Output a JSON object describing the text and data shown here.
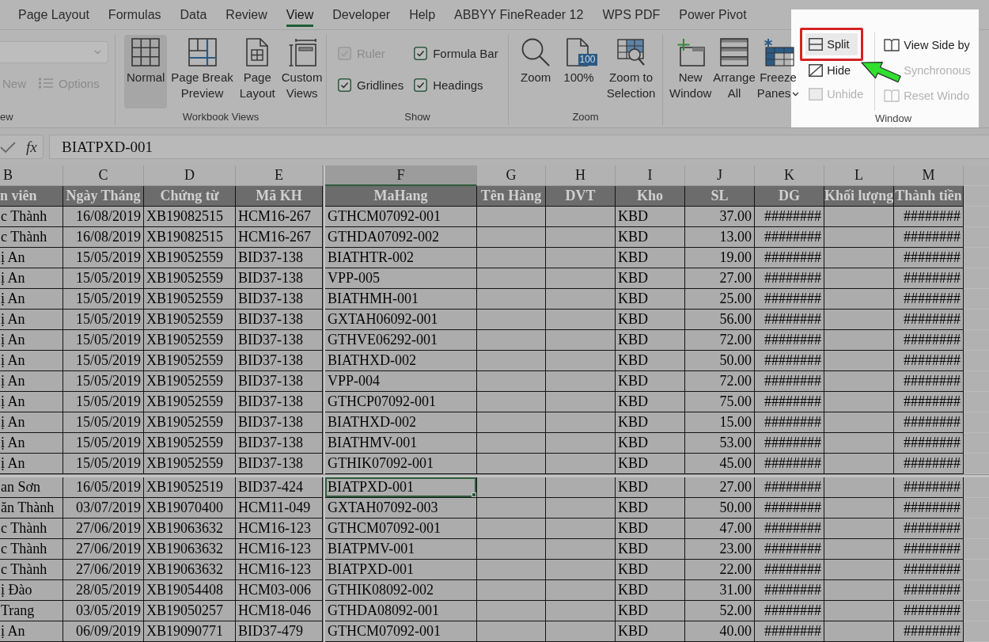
{
  "tabs": [
    {
      "label": "Page Layout",
      "selected": false
    },
    {
      "label": "Formulas",
      "selected": false
    },
    {
      "label": "Data",
      "selected": false
    },
    {
      "label": "Review",
      "selected": false
    },
    {
      "label": "View",
      "selected": true
    },
    {
      "label": "Developer",
      "selected": false
    },
    {
      "label": "Help",
      "selected": false
    },
    {
      "label": "ABBYY FineReader 12",
      "selected": false
    },
    {
      "label": "WPS PDF",
      "selected": false
    },
    {
      "label": "Power Pivot",
      "selected": false
    }
  ],
  "ribbon": {
    "sheet_view": {
      "label": "ew",
      "selector": {
        "disabled": true
      },
      "buttons": [
        {
          "label": "New",
          "kind": "plain",
          "disabled": true
        },
        {
          "label": "Options",
          "kind": "list",
          "disabled": true
        }
      ]
    },
    "workbook_views": {
      "label": "Workbook Views",
      "buttons": [
        {
          "label": "Normal",
          "kind": "normal",
          "selected": true
        },
        {
          "label": "Page Break Preview",
          "kind": "page_break",
          "selected": false
        },
        {
          "label": "Page Layout",
          "kind": "page_layout",
          "selected": false
        },
        {
          "label": "Custom Views",
          "kind": "custom_views",
          "selected": false
        }
      ]
    },
    "show": {
      "label": "Show",
      "options": [
        {
          "label": "Ruler",
          "checked": true,
          "disabled": true
        },
        {
          "label": "Formula Bar",
          "checked": true,
          "disabled": false
        },
        {
          "label": "Gridlines",
          "checked": true,
          "disabled": false
        },
        {
          "label": "Headings",
          "checked": true,
          "disabled": false
        }
      ]
    },
    "zoom": {
      "label": "Zoom",
      "buttons": [
        {
          "label": "Zoom",
          "kind": "zoom"
        },
        {
          "label": "100%",
          "kind": "actual_size",
          "badge": "100"
        },
        {
          "label": "Zoom to Selection",
          "kind": "zoom_selection"
        }
      ]
    },
    "window": {
      "label": "Window",
      "spotlight": true,
      "buttons": [
        {
          "label": "New Window",
          "kind": "new_window",
          "dropdown": false
        },
        {
          "label": "Arrange All",
          "kind": "arrange_all",
          "dropdown": false
        },
        {
          "label": "Freeze Panes",
          "kind": "freeze_panes",
          "dropdown": true
        }
      ],
      "small_button_columns": [
        {
          "buttons": [
            {
              "label": "Split",
              "kind": "split",
              "disabled": false,
              "highlighted": true
            },
            {
              "label": "Hide",
              "kind": "hide",
              "disabled": false,
              "highlighted": false
            },
            {
              "label": "Unhide",
              "kind": "unhide",
              "disabled": true,
              "highlighted": false
            }
          ]
        },
        {
          "buttons": [
            {
              "label": "View Side by",
              "kind": "side_by_side",
              "disabled": false,
              "highlighted": false
            },
            {
              "label": "Synchronous",
              "kind": "sync_scroll",
              "disabled": true,
              "highlighted": false
            },
            {
              "label": "Reset Windo",
              "kind": "reset_position",
              "disabled": true,
              "highlighted": false
            }
          ]
        }
      ]
    }
  },
  "formula_bar": {
    "function_label": "fx",
    "value": "BIATPXD-001"
  },
  "sheet": {
    "left_columns": [
      {
        "letter": "B",
        "header": "n viên",
        "kind": "text",
        "selected": false
      },
      {
        "letter": "C",
        "header": "Ngày Tháng",
        "kind": "date",
        "selected": false
      },
      {
        "letter": "D",
        "header": "Chứng từ",
        "kind": "text",
        "selected": false
      },
      {
        "letter": "E",
        "header": "Mã KH",
        "kind": "text",
        "selected": false
      }
    ],
    "right_columns": [
      {
        "letter": "F",
        "header": "MaHang",
        "kind": "text",
        "selected": true
      },
      {
        "letter": "G",
        "header": "Tên Hàng",
        "selected": false
      },
      {
        "letter": "H",
        "header": "DVT",
        "selected": false
      },
      {
        "letter": "I",
        "header": "Kho",
        "kind": "text",
        "selected": false
      },
      {
        "letter": "J",
        "header": "SL",
        "kind": "number",
        "selected": false
      },
      {
        "letter": "K",
        "header": "DG",
        "kind": "number",
        "selected": false
      },
      {
        "letter": "L",
        "header": "Khối lượng",
        "selected": false
      },
      {
        "letter": "M",
        "header": "Thành tiền",
        "kind": "number",
        "selected": false
      }
    ],
    "top_pane_rows": [
      {
        "selected": false,
        "column_b": "c Thành",
        "date": "16/08/2019",
        "voucher": "XB19082515",
        "customer_code": "HCM16-267",
        "item_code": "GTHCM07092-001",
        "warehouse": "KBD",
        "quantity": "37.00",
        "unit_price": "########",
        "amount": "########"
      },
      {
        "selected": false,
        "column_b": "c Thành",
        "date": "16/08/2019",
        "voucher": "XB19082515",
        "customer_code": "HCM16-267",
        "item_code": "GTHDA07092-002",
        "warehouse": "KBD",
        "quantity": "13.00",
        "unit_price": "########",
        "amount": "########"
      },
      {
        "selected": false,
        "column_b": "ị An",
        "date": "15/05/2019",
        "voucher": "XB19052559",
        "customer_code": "BID37-138",
        "item_code": "BIATHTR-002",
        "warehouse": "KBD",
        "quantity": "19.00",
        "unit_price": "########",
        "amount": "########"
      },
      {
        "selected": false,
        "column_b": "ị An",
        "date": "15/05/2019",
        "voucher": "XB19052559",
        "customer_code": "BID37-138",
        "item_code": "VPP-005",
        "warehouse": "KBD",
        "quantity": "27.00",
        "unit_price": "########",
        "amount": "########"
      },
      {
        "selected": false,
        "column_b": "ị An",
        "date": "15/05/2019",
        "voucher": "XB19052559",
        "customer_code": "BID37-138",
        "item_code": "BIATHMH-001",
        "warehouse": "KBD",
        "quantity": "25.00",
        "unit_price": "########",
        "amount": "########"
      },
      {
        "selected": false,
        "column_b": "ị An",
        "date": "15/05/2019",
        "voucher": "XB19052559",
        "customer_code": "BID37-138",
        "item_code": "GXTAH06092-001",
        "warehouse": "KBD",
        "quantity": "56.00",
        "unit_price": "########",
        "amount": "########"
      },
      {
        "selected": false,
        "column_b": "ị An",
        "date": "15/05/2019",
        "voucher": "XB19052559",
        "customer_code": "BID37-138",
        "item_code": "GTHVE06292-001",
        "warehouse": "KBD",
        "quantity": "72.00",
        "unit_price": "########",
        "amount": "########"
      },
      {
        "selected": false,
        "column_b": "ị An",
        "date": "15/05/2019",
        "voucher": "XB19052559",
        "customer_code": "BID37-138",
        "item_code": "BIATHXD-002",
        "warehouse": "KBD",
        "quantity": "50.00",
        "unit_price": "########",
        "amount": "########"
      },
      {
        "selected": false,
        "column_b": "ị An",
        "date": "15/05/2019",
        "voucher": "XB19052559",
        "customer_code": "BID37-138",
        "item_code": "VPP-004",
        "warehouse": "KBD",
        "quantity": "72.00",
        "unit_price": "########",
        "amount": "########"
      },
      {
        "selected": false,
        "column_b": "ị An",
        "date": "15/05/2019",
        "voucher": "XB19052559",
        "customer_code": "BID37-138",
        "item_code": "GTHCP07092-001",
        "warehouse": "KBD",
        "quantity": "75.00",
        "unit_price": "########",
        "amount": "########"
      },
      {
        "selected": false,
        "column_b": "ị An",
        "date": "15/05/2019",
        "voucher": "XB19052559",
        "customer_code": "BID37-138",
        "item_code": "BIATHXD-002",
        "warehouse": "KBD",
        "quantity": "15.00",
        "unit_price": "########",
        "amount": "########"
      },
      {
        "selected": false,
        "column_b": "ị An",
        "date": "15/05/2019",
        "voucher": "XB19052559",
        "customer_code": "BID37-138",
        "item_code": "BIATHMV-001",
        "warehouse": "KBD",
        "quantity": "53.00",
        "unit_price": "########",
        "amount": "########"
      },
      {
        "selected": false,
        "column_b": "ị An",
        "date": "15/05/2019",
        "voucher": "XB19052559",
        "customer_code": "BID37-138",
        "item_code": "GTHIK07092-001",
        "warehouse": "KBD",
        "quantity": "45.00",
        "unit_price": "########",
        "amount": "########"
      }
    ],
    "bottom_pane_rows": [
      {
        "selected": true,
        "column_b": "an Sơn",
        "date": "16/05/2019",
        "voucher": "XB19052519",
        "customer_code": "BID37-424",
        "item_code": "BIATPXD-001",
        "warehouse": "KBD",
        "quantity": "27.00",
        "unit_price": "########",
        "amount": "########"
      },
      {
        "selected": false,
        "column_b": "ăn Thành",
        "date": "03/07/2019",
        "voucher": "XB19070400",
        "customer_code": "HCM11-049",
        "item_code": "GXTAH07092-003",
        "warehouse": "KBD",
        "quantity": "50.00",
        "unit_price": "########",
        "amount": "########"
      },
      {
        "selected": false,
        "column_b": "c Thành",
        "date": "27/06/2019",
        "voucher": "XB19063632",
        "customer_code": "HCM16-123",
        "item_code": "GTHCM07092-001",
        "warehouse": "KBD",
        "quantity": "47.00",
        "unit_price": "########",
        "amount": "########"
      },
      {
        "selected": false,
        "column_b": "c Thành",
        "date": "27/06/2019",
        "voucher": "XB19063632",
        "customer_code": "HCM16-123",
        "item_code": "BIATPMV-001",
        "warehouse": "KBD",
        "quantity": "23.00",
        "unit_price": "########",
        "amount": "########"
      },
      {
        "selected": false,
        "column_b": "c Thành",
        "date": "27/06/2019",
        "voucher": "XB19063632",
        "customer_code": "HCM16-123",
        "item_code": "BIATPXD-001",
        "warehouse": "KBD",
        "quantity": "22.00",
        "unit_price": "########",
        "amount": "########"
      },
      {
        "selected": false,
        "column_b": "ị Đào",
        "date": "28/05/2019",
        "voucher": "XB19054408",
        "customer_code": "HCM03-006",
        "item_code": "GTHIK08092-002",
        "warehouse": "KBD",
        "quantity": "31.00",
        "unit_price": "########",
        "amount": "########"
      },
      {
        "selected": false,
        "column_b": "Trang",
        "date": "03/05/2019",
        "voucher": "XB19050257",
        "customer_code": "HCM18-046",
        "item_code": "GTHDA08092-001",
        "warehouse": "KBD",
        "quantity": "52.00",
        "unit_price": "########",
        "amount": "########"
      },
      {
        "selected": false,
        "column_b": "ị An",
        "date": "06/09/2019",
        "voucher": "XB19090771",
        "customer_code": "BID37-479",
        "item_code": "GTHCM07092-001",
        "warehouse": "KBD",
        "quantity": "40.00",
        "unit_price": "########",
        "amount": "########"
      }
    ]
  }
}
